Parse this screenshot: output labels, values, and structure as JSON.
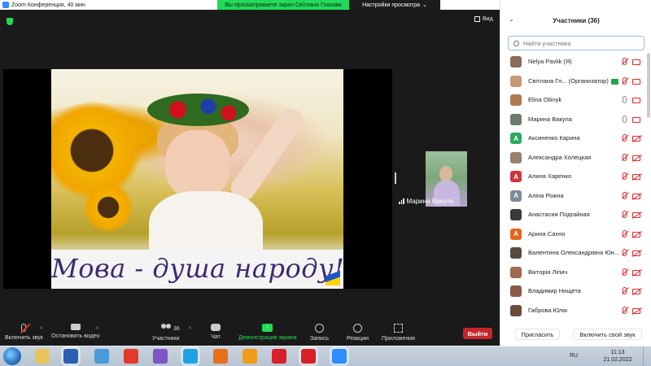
{
  "window": {
    "title": "Zoom Конференция, 40 мин",
    "share_banner": "Вы просматриваете экран Світлана Глазова",
    "view_options": "Настройки просмотра",
    "view_options_caret": "⌄",
    "view_label": "Вид"
  },
  "shared_content": {
    "caption": "Мова  - душа народу!"
  },
  "thumbnail": {
    "name": "Марина Вакула"
  },
  "toolbar": {
    "unmute": "Включить звук",
    "start_video": "Остановить видео",
    "participants": "Участники",
    "participants_count": "36",
    "chat": "Чат",
    "share": "Демонстрация экрана",
    "record": "Запись",
    "reactions": "Реакции",
    "apps": "Приложения",
    "leave": "Выйти",
    "caret": "^"
  },
  "panel": {
    "title": "Участники (36)",
    "chevron": "⌄",
    "search_placeholder": "Найти участника",
    "invite": "Пригласить",
    "unmute_me": "Включить свой звук",
    "participants": [
      {
        "name": "Nelya Pavlik (Я)",
        "avatar": "",
        "color": "#8a6b5a",
        "mic": "muted",
        "cam": "on"
      },
      {
        "name": "Світлана Гл... (Организатор)",
        "avatar": "",
        "color": "#c49a7a",
        "mic": "muted",
        "cam": "on",
        "sharing": true
      },
      {
        "name": "Elina Oliinyk",
        "avatar": "",
        "color": "#b07a50",
        "mic": "on",
        "cam": "on"
      },
      {
        "name": "Марина Вакула",
        "avatar": "",
        "color": "#6b7a6a",
        "mic": "on",
        "cam": "on"
      },
      {
        "name": "Аксиненко Карина",
        "avatar": "А",
        "color": "#2eaa5f",
        "mic": "muted",
        "cam": "off"
      },
      {
        "name": "Александра Холецкая",
        "avatar": "",
        "color": "#9a8070",
        "mic": "muted",
        "cam": "off"
      },
      {
        "name": "Алина Харенко",
        "avatar": "А",
        "color": "#d0343a",
        "mic": "muted",
        "cam": "off"
      },
      {
        "name": "Аліна Рожна",
        "avatar": "А",
        "color": "#7d8c9c",
        "mic": "muted",
        "cam": "off"
      },
      {
        "name": "Анастасия Подгайная",
        "avatar": "",
        "color": "#3a3a3a",
        "mic": "muted",
        "cam": "off"
      },
      {
        "name": "Арина Сахно",
        "avatar": "А",
        "color": "#e2661e",
        "mic": "muted",
        "cam": "off"
      },
      {
        "name": "Валентина Олександрівна Юн...",
        "avatar": "",
        "color": "#5a4a40",
        "mic": "muted",
        "cam": "off"
      },
      {
        "name": "Вікторія Ліпич",
        "avatar": "",
        "color": "#a06a50",
        "mic": "muted",
        "cam": "off"
      },
      {
        "name": "Владимир Нищета",
        "avatar": "",
        "color": "#8a5a4a",
        "mic": "muted",
        "cam": "off"
      },
      {
        "name": "Габрова Юлія",
        "avatar": "",
        "color": "#6a4a3a",
        "mic": "muted",
        "cam": "off"
      }
    ]
  },
  "taskbar": {
    "language": "RU",
    "time": "11:13",
    "date": "21.02.2022",
    "apps": [
      {
        "name": "explorer",
        "color": "#e8c45a"
      },
      {
        "name": "word",
        "color": "#2b5fb0",
        "active": true
      },
      {
        "name": "chrome",
        "color": "#4a9ad8"
      },
      {
        "name": "yandex",
        "color": "#e23a2a"
      },
      {
        "name": "media",
        "color": "#7a56c8"
      },
      {
        "name": "skype",
        "color": "#1fa3e8",
        "active": true
      },
      {
        "name": "firefox",
        "color": "#e8701a"
      },
      {
        "name": "avast",
        "color": "#f29a1a"
      },
      {
        "name": "opera",
        "color": "#d8202a"
      },
      {
        "name": "opera-active",
        "color": "#d8202a",
        "active": true
      },
      {
        "name": "zoom",
        "color": "#2d8cff",
        "active": true
      }
    ]
  }
}
